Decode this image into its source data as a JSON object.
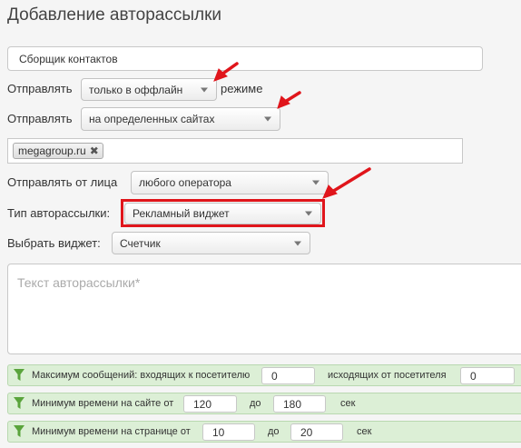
{
  "page_title": "Добавление авторассылки",
  "name_field": {
    "value": "Сборщик контактов"
  },
  "send_mode": {
    "label": "Отправлять",
    "value": "только в оффлайн",
    "suffix": "режиме"
  },
  "send_sites": {
    "label": "Отправлять",
    "value": "на определенных сайтах"
  },
  "sites_tags": [
    "megagroup.ru"
  ],
  "tag_remove_glyph": "✖",
  "send_as": {
    "label": "Отправлять от лица",
    "value": "любого оператора"
  },
  "mailing_type": {
    "label": "Тип авторассылки:",
    "value": "Рекламный виджет"
  },
  "widget": {
    "label": "Выбрать виджет:",
    "value": "Счетчик"
  },
  "message_text": {
    "placeholder": "Текст авторассылки*"
  },
  "conditions": [
    {
      "label": "Максимум сообщений: входящих к посетителю",
      "value1": "0",
      "mid_label": "исходящих от посетителя",
      "value2": "0",
      "unit": ""
    },
    {
      "label": "Минимум времени на сайте от",
      "value1": "120",
      "mid_label": "до",
      "value2": "180",
      "unit": "сек"
    },
    {
      "label": "Минимум времени на странице от",
      "value1": "10",
      "mid_label": "до",
      "value2": "20",
      "unit": "сек"
    }
  ],
  "colors": {
    "arrow": "#e0151b",
    "highlight": "#e0151b",
    "condition_bg": "#dcefd6",
    "funnel": "#5aa43c"
  },
  "icons": {
    "arrow": "red-arrow-icon",
    "funnel": "funnel-icon",
    "remove": "close-icon",
    "caret": "chevron-down-icon"
  }
}
